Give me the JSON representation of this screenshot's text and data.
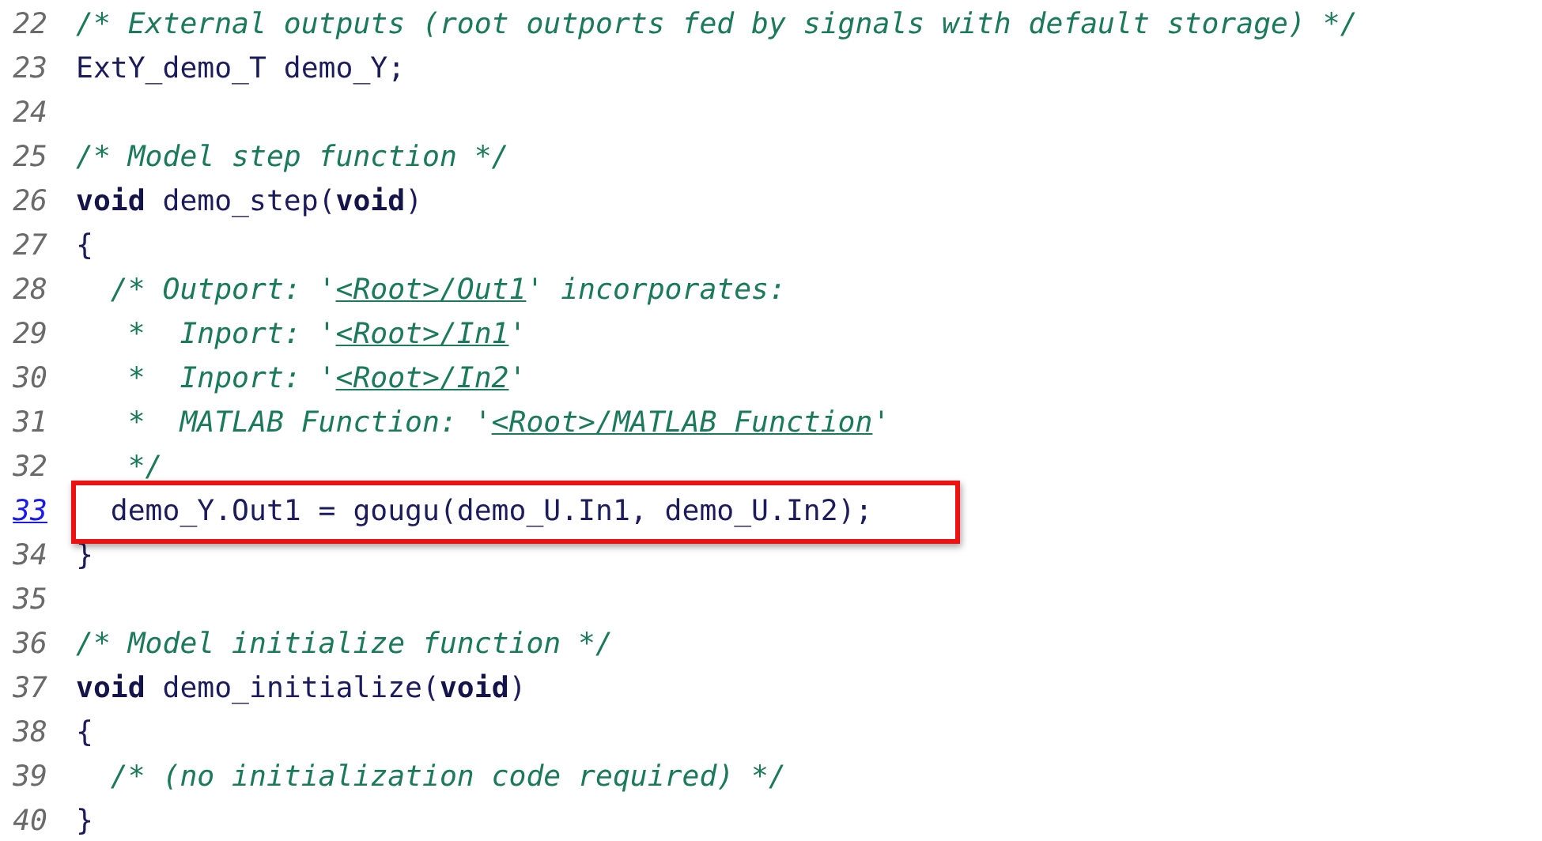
{
  "lines": [
    {
      "number": "22",
      "number_link": false,
      "highlighted": false,
      "segments": [
        {
          "kind": "comment",
          "text": "/* External outputs (root outports fed by signals with default storage) */"
        }
      ]
    },
    {
      "number": "23",
      "number_link": false,
      "highlighted": false,
      "segments": [
        {
          "kind": "code",
          "text": "ExtY_demo_T demo_Y;"
        }
      ]
    },
    {
      "number": "24",
      "number_link": false,
      "highlighted": false
    },
    {
      "number": "25",
      "number_link": false,
      "highlighted": false,
      "segments": [
        {
          "kind": "comment",
          "text": "/* Model step function */"
        }
      ]
    },
    {
      "number": "26",
      "number_link": false,
      "highlighted": false,
      "segments": [
        {
          "kind": "keyword",
          "text": "void"
        },
        {
          "kind": "code",
          "text": " demo_step("
        },
        {
          "kind": "keyword",
          "text": "void"
        },
        {
          "kind": "code",
          "text": ")"
        }
      ]
    },
    {
      "number": "27",
      "number_link": false,
      "highlighted": false,
      "segments": [
        {
          "kind": "code",
          "text": "{"
        }
      ]
    },
    {
      "number": "28",
      "number_link": false,
      "highlighted": false,
      "segments": [
        {
          "kind": "comment",
          "text": "  /* Outport: '"
        },
        {
          "kind": "link",
          "text": "<Root>/Out1"
        },
        {
          "kind": "comment",
          "text": "' incorporates:"
        }
      ]
    },
    {
      "number": "29",
      "number_link": false,
      "highlighted": false,
      "segments": [
        {
          "kind": "comment",
          "text": "   *  Inport: '"
        },
        {
          "kind": "link",
          "text": "<Root>/In1"
        },
        {
          "kind": "comment",
          "text": "'"
        }
      ]
    },
    {
      "number": "30",
      "number_link": false,
      "highlighted": false,
      "segments": [
        {
          "kind": "comment",
          "text": "   *  Inport: '"
        },
        {
          "kind": "link",
          "text": "<Root>/In2"
        },
        {
          "kind": "comment",
          "text": "'"
        }
      ]
    },
    {
      "number": "31",
      "number_link": false,
      "highlighted": false,
      "segments": [
        {
          "kind": "comment",
          "text": "   *  MATLAB Function: '"
        },
        {
          "kind": "link",
          "text": "<Root>/MATLAB Function"
        },
        {
          "kind": "comment",
          "text": "'"
        }
      ]
    },
    {
      "number": "32",
      "number_link": false,
      "highlighted": false,
      "segments": [
        {
          "kind": "comment",
          "text": "   */"
        }
      ]
    },
    {
      "number": "33",
      "number_link": true,
      "highlighted": true,
      "segments": [
        {
          "kind": "code",
          "text": "  demo_Y.Out1 = gougu(demo_U.In1, demo_U.In2);"
        }
      ]
    },
    {
      "number": "34",
      "number_link": false,
      "highlighted": false,
      "segments": [
        {
          "kind": "code",
          "text": "}"
        }
      ]
    },
    {
      "number": "35",
      "number_link": false,
      "highlighted": false
    },
    {
      "number": "36",
      "number_link": false,
      "highlighted": false,
      "segments": [
        {
          "kind": "comment",
          "text": "/* Model initialize function */"
        }
      ]
    },
    {
      "number": "37",
      "number_link": false,
      "highlighted": false,
      "segments": [
        {
          "kind": "keyword",
          "text": "void"
        },
        {
          "kind": "code",
          "text": " demo_initialize("
        },
        {
          "kind": "keyword",
          "text": "void"
        },
        {
          "kind": "code",
          "text": ")"
        }
      ]
    },
    {
      "number": "38",
      "number_link": false,
      "highlighted": false,
      "segments": [
        {
          "kind": "code",
          "text": "{"
        }
      ]
    },
    {
      "number": "39",
      "number_link": false,
      "highlighted": false,
      "segments": [
        {
          "kind": "comment",
          "text": "  /* (no initialization code required) */"
        }
      ]
    },
    {
      "number": "40",
      "number_link": false,
      "highlighted": false,
      "segments": [
        {
          "kind": "code",
          "text": "}"
        }
      ]
    }
  ]
}
